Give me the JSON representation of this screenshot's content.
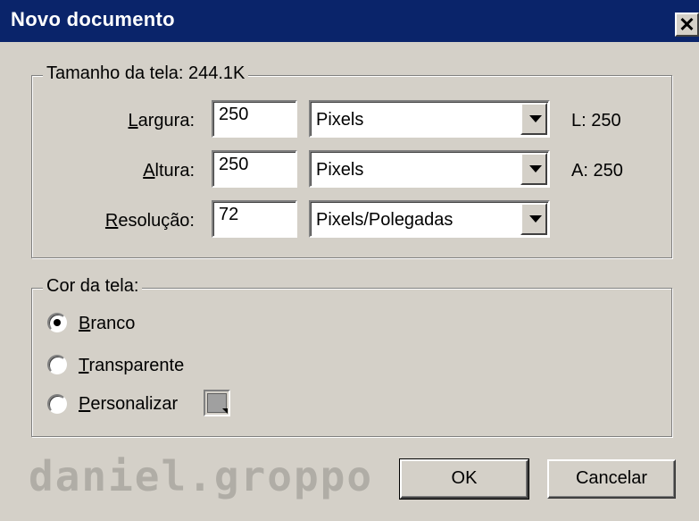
{
  "window": {
    "title": "Novo documento",
    "close_label": "✕"
  },
  "canvas_size": {
    "group_label": "Tamanho da tela: 244.1K",
    "width": {
      "label_ul": "L",
      "label_rest": "argura:",
      "value": "250",
      "unit": "Pixels",
      "info": "L: 250"
    },
    "height": {
      "label_ul": "A",
      "label_rest": "ltura:",
      "value": "250",
      "unit": "Pixels",
      "info": "A: 250"
    },
    "resolution": {
      "label_ul": "R",
      "label_rest": "esolução:",
      "value": "72",
      "unit": "Pixels/Polegadas"
    }
  },
  "canvas_color": {
    "group_label": "Cor da tela:",
    "options": [
      {
        "ul": "B",
        "rest": "ranco",
        "selected": true
      },
      {
        "ul": "T",
        "rest": "ransparente",
        "selected": false
      },
      {
        "ul": "P",
        "rest": "ersonalizar",
        "selected": false
      }
    ],
    "swatch_color": "#a0a0a0"
  },
  "buttons": {
    "ok": "OK",
    "cancel": "Cancelar"
  },
  "watermark": "daniel.groppo",
  "icons": {
    "close": "close-icon",
    "dropdown": "chevron-down-icon",
    "swatch": "color-swatch-icon"
  }
}
